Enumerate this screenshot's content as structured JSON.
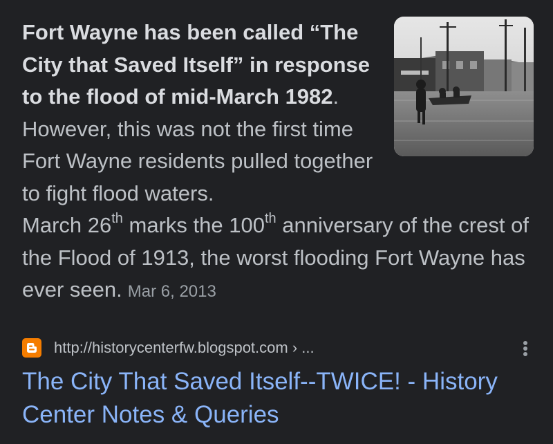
{
  "snippet": {
    "bold_text": "Fort Wayne has been called “The City that Saved Itself” in response to the flood of mid-March 1982",
    "text_after_bold": ". However, this was not the first time Fort Wayne residents pulled together to fight flood waters.",
    "line2_a": "March 26",
    "line2_sup1": "th",
    "line2_b": " marks the 100",
    "line2_sup2": "th",
    "line2_c": " anniversary of the crest of the Flood of 1913, the worst flooding Fort Wayne has ever seen.",
    "date": "Mar 6, 2013"
  },
  "thumbnail": {
    "icon": "flood-photo"
  },
  "source": {
    "favicon": "blogger-icon",
    "favicon_color": "#f57d00",
    "url": "http://historycenterfw.blogspot.com › ..."
  },
  "result": {
    "title": "The City That Saved Itself--TWICE! - History Center Notes & Queries",
    "link_color": "#8ab4f8"
  },
  "menu": {
    "icon": "more-vert-icon"
  }
}
